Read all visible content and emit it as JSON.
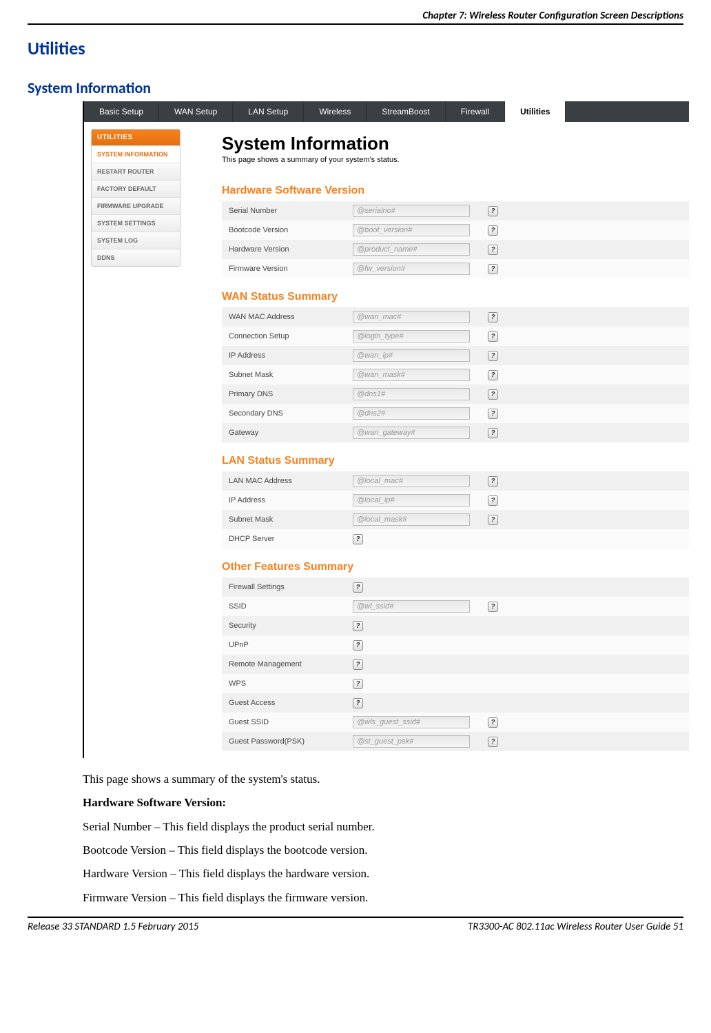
{
  "chapter_header": "Chapter 7: Wireless Router Configuration Screen Descriptions",
  "h1": "Utilities",
  "h2": "System Information",
  "topnav": {
    "tabs": [
      "Basic Setup",
      "WAN Setup",
      "LAN Setup",
      "Wireless",
      "StreamBoost",
      "Firewall",
      "Utilities"
    ],
    "active_index": 6
  },
  "sidebar": {
    "header": "UTILITIES",
    "items": [
      "SYSTEM INFORMATION",
      "RESTART ROUTER",
      "FACTORY DEFAULT",
      "FIRMWARE UPGRADE",
      "SYSTEM SETTINGS",
      "SYSTEM LOG",
      "DDNS"
    ],
    "active_index": 0
  },
  "content": {
    "title": "System Information",
    "subtitle": "This page shows a summary of your system's status.",
    "help_glyph": "?",
    "sections": [
      {
        "title": "Hardware Software Version",
        "rows": [
          {
            "label": "Serial Number",
            "value": "@serialno#",
            "has_value": true
          },
          {
            "label": "Bootcode Version",
            "value": "@boot_version#",
            "has_value": true
          },
          {
            "label": "Hardware Version",
            "value": "@product_name#",
            "has_value": true
          },
          {
            "label": "Firmware Version",
            "value": "@fw_version#",
            "has_value": true
          }
        ]
      },
      {
        "title": "WAN Status Summary",
        "rows": [
          {
            "label": "WAN MAC Address",
            "value": "@wan_mac#",
            "has_value": true
          },
          {
            "label": "Connection Setup",
            "value": "@login_type#",
            "has_value": true
          },
          {
            "label": "IP Address",
            "value": "@wan_ip#",
            "has_value": true
          },
          {
            "label": "Subnet Mask",
            "value": "@wan_mask#",
            "has_value": true
          },
          {
            "label": "Primary DNS",
            "value": "@dns1#",
            "has_value": true
          },
          {
            "label": "Secondary DNS",
            "value": "@dns2#",
            "has_value": true
          },
          {
            "label": "Gateway",
            "value": "@wan_gateway#",
            "has_value": true
          }
        ]
      },
      {
        "title": "LAN Status Summary",
        "rows": [
          {
            "label": "LAN MAC Address",
            "value": "@local_mac#",
            "has_value": true
          },
          {
            "label": "IP Address",
            "value": "@local_ip#",
            "has_value": true
          },
          {
            "label": "Subnet Mask",
            "value": "@local_mask#",
            "has_value": true
          },
          {
            "label": "DHCP Server",
            "value": "",
            "has_value": false
          }
        ]
      },
      {
        "title": "Other Features Summary",
        "rows": [
          {
            "label": "Firewall Settings",
            "value": "",
            "has_value": false
          },
          {
            "label": "SSID",
            "value": "@wl_ssid#",
            "has_value": true
          },
          {
            "label": "Security",
            "value": "",
            "has_value": false
          },
          {
            "label": "UPnP",
            "value": "",
            "has_value": false
          },
          {
            "label": "Remote Management",
            "value": "",
            "has_value": false
          },
          {
            "label": "WPS",
            "value": "",
            "has_value": false
          },
          {
            "label": "Guest Access",
            "value": "",
            "has_value": false
          },
          {
            "label": "Guest SSID",
            "value": "@wls_guest_ssid#",
            "has_value": true
          },
          {
            "label": "Guest Password(PSK)",
            "value": "@st_guest_psk#",
            "has_value": true
          }
        ]
      }
    ]
  },
  "body": {
    "p0": "This page shows a summary of the system's status.",
    "h": "Hardware Software Version:",
    "p1": "Serial Number – This field displays the product serial number.",
    "p2": "Bootcode Version – This field displays the bootcode version.",
    "p3": "Hardware Version – This field displays the hardware version.",
    "p4": "Firmware Version – This field displays the firmware version."
  },
  "footer": {
    "left": "Release 33 STANDARD 1.5    February 2015",
    "right": "TR3300-AC 802.11ac Wireless Router User Guide    51"
  }
}
